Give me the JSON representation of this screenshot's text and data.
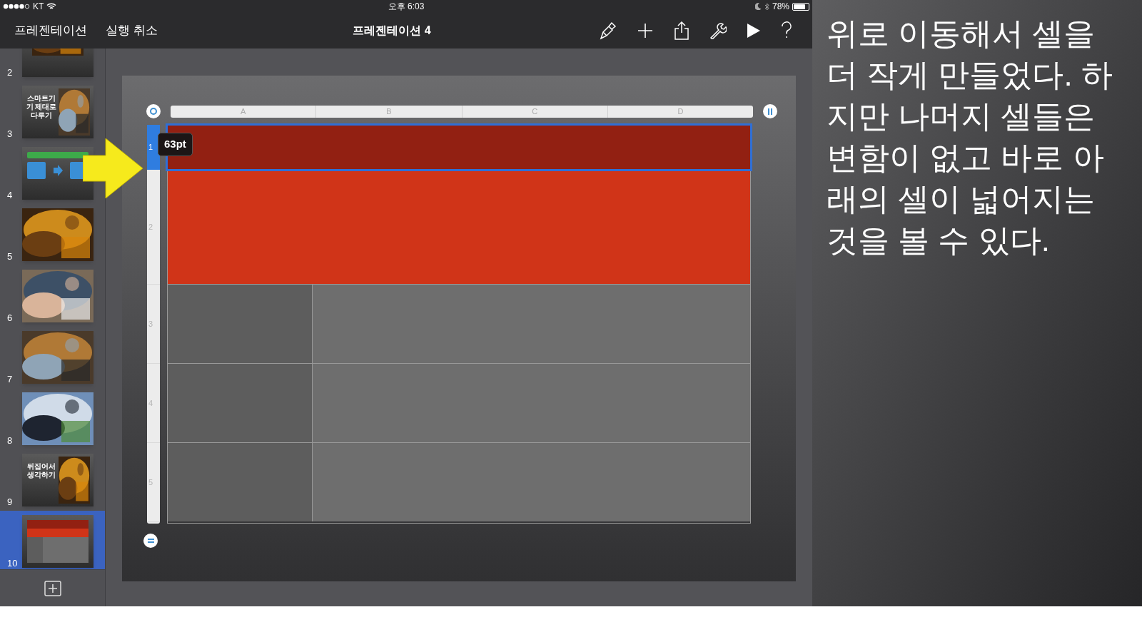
{
  "status_bar": {
    "carrier": "KT",
    "time": "오후 6:03",
    "battery": "78%"
  },
  "toolbar": {
    "left_buttons": [
      "프레젠테이션",
      "실행 취소"
    ],
    "title": "프레젠테이션 4"
  },
  "slides": [
    {
      "number": "2",
      "kind": "caption",
      "selected": false
    },
    {
      "number": "3",
      "kind": "title",
      "title": "스마트기기 제대로 다루기",
      "selected": false
    },
    {
      "number": "4",
      "kind": "diagram",
      "selected": false
    },
    {
      "number": "5",
      "selected": false
    },
    {
      "number": "6",
      "selected": false
    },
    {
      "number": "7",
      "selected": false
    },
    {
      "number": "8",
      "selected": false
    },
    {
      "number": "9",
      "kind": "title",
      "title": "뒤집어서 생각하기",
      "selected": false
    },
    {
      "number": "10",
      "kind": "table",
      "selected": true
    }
  ],
  "table": {
    "columns": [
      "A",
      "B",
      "C",
      "D"
    ],
    "rows": [
      {
        "number": "1",
        "kind": "band",
        "color": "#922012",
        "selected": true
      },
      {
        "number": "2",
        "kind": "band",
        "color": "#d03418",
        "selected": false
      },
      {
        "number": "3",
        "kind": "split",
        "color": "#5d5d5d",
        "selected": false
      },
      {
        "number": "4",
        "kind": "split",
        "color": "#5d5d5d",
        "selected": false
      },
      {
        "number": "5",
        "kind": "split",
        "color": "#5d5d5d",
        "selected": false
      }
    ],
    "size_label": "63pt"
  },
  "caption": "위로 이동해서 셀을 더 작게 만들었다. 하지만 나머지 셀들은 변함이 없고 바로 아래의 셀이 넓어지는 것을 볼 수 있다."
}
